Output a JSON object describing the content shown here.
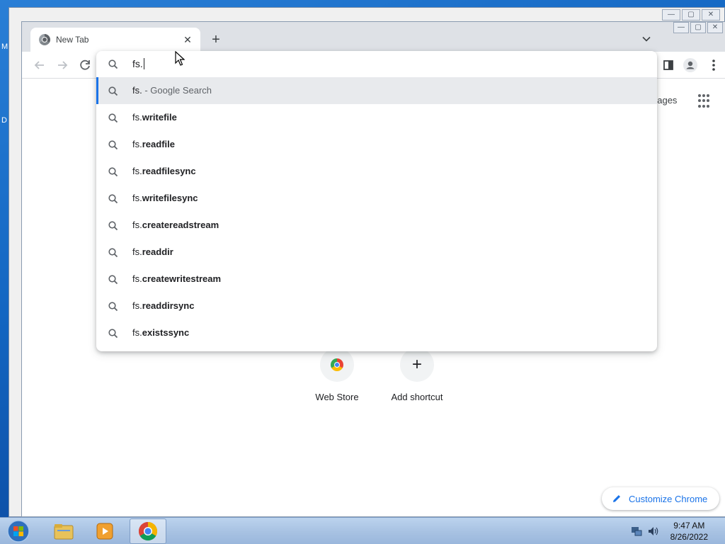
{
  "desktop": {
    "fragments": [
      "M",
      "D"
    ]
  },
  "browser": {
    "tab": {
      "title": "New Tab",
      "close": "✕"
    },
    "new_tab": "+",
    "window_controls": [
      "—",
      "▢",
      "✕"
    ]
  },
  "omnibox": {
    "query": "fs.",
    "suggestions": [
      {
        "prefix": "fs.",
        "bold": "",
        "suffix": " - Google Search",
        "selected": true
      },
      {
        "prefix": "fs.",
        "bold": "writefile",
        "suffix": ""
      },
      {
        "prefix": "fs.",
        "bold": "readfile",
        "suffix": ""
      },
      {
        "prefix": "fs.",
        "bold": "readfilesync",
        "suffix": ""
      },
      {
        "prefix": "fs.",
        "bold": "writefilesync",
        "suffix": ""
      },
      {
        "prefix": "fs.",
        "bold": "createreadstream",
        "suffix": ""
      },
      {
        "prefix": "fs.",
        "bold": "readdir",
        "suffix": ""
      },
      {
        "prefix": "fs.",
        "bold": "createwritestream",
        "suffix": ""
      },
      {
        "prefix": "fs.",
        "bold": "readdirsync",
        "suffix": ""
      },
      {
        "prefix": "fs.",
        "bold": "existssync",
        "suffix": ""
      }
    ]
  },
  "ntp": {
    "images_link": "nages",
    "shortcuts": [
      {
        "label": "Web Store",
        "icon": "chrome-web-store-icon"
      },
      {
        "label": "Add shortcut",
        "icon": "plus-icon"
      }
    ],
    "customize": "Customize Chrome"
  },
  "taskbar": {
    "time": "9:47 AM",
    "date": "8/26/2022"
  },
  "colors": {
    "accent": "#1a73e8",
    "selected_row": "#e8eaed",
    "tabstrip": "#dee1e6"
  }
}
